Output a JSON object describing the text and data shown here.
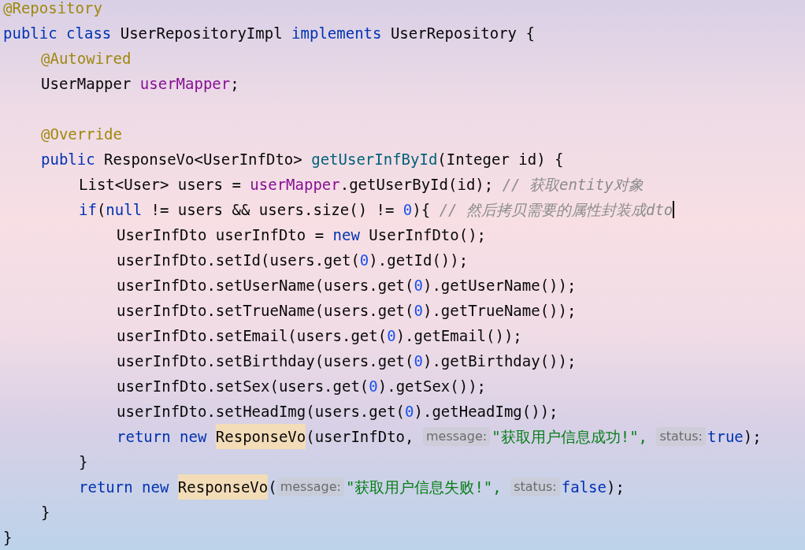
{
  "code": [
    {
      "tokens": [
        {
          "kind": "annotation",
          "text": "@Repository"
        }
      ]
    },
    {
      "tokens": [
        {
          "kind": "keyword",
          "text": "public class "
        },
        {
          "kind": "plain",
          "text": "UserRepositoryImpl "
        },
        {
          "kind": "keyword",
          "text": "implements "
        },
        {
          "kind": "plain",
          "text": "UserRepository {"
        }
      ],
      "children": [
        {
          "tokens": [
            {
              "kind": "annotation",
              "text": "@Autowired"
            }
          ]
        },
        {
          "tokens": [
            {
              "kind": "plain",
              "text": "UserMapper "
            },
            {
              "kind": "field",
              "text": "userMapper"
            },
            {
              "kind": "plain",
              "text": ";"
            }
          ]
        },
        {
          "blank_before": true,
          "tokens": [
            {
              "kind": "annotation",
              "text": "@Override"
            }
          ]
        },
        {
          "tokens": [
            {
              "kind": "keyword",
              "text": "public "
            },
            {
              "kind": "plain",
              "text": "ResponseVo<UserInfDto> "
            },
            {
              "kind": "method",
              "text": "getUserInfById"
            },
            {
              "kind": "plain",
              "text": "(Integer id) {"
            }
          ],
          "children": [
            {
              "tokens": [
                {
                  "kind": "plain",
                  "text": "List<User> users = "
                },
                {
                  "kind": "field",
                  "text": "userMapper"
                },
                {
                  "kind": "plain",
                  "text": ".getUserById(id); "
                },
                {
                  "kind": "comment",
                  "text": "// 获取entity对象"
                }
              ]
            },
            {
              "caret": true,
              "tokens": [
                {
                  "kind": "keyword",
                  "text": "if"
                },
                {
                  "kind": "plain",
                  "text": "("
                },
                {
                  "kind": "keyword",
                  "text": "null"
                },
                {
                  "kind": "plain",
                  "text": " != users && users.size() != "
                },
                {
                  "kind": "number",
                  "text": "0"
                },
                {
                  "kind": "plain",
                  "text": "){ "
                },
                {
                  "kind": "comment",
                  "text": "// 然后拷贝需要的属性封装成dto"
                }
              ],
              "children": [
                {
                  "tokens": [
                    {
                      "kind": "plain",
                      "text": "UserInfDto userInfDto = "
                    },
                    {
                      "kind": "keyword",
                      "text": "new "
                    },
                    {
                      "kind": "plain",
                      "text": "UserInfDto();"
                    }
                  ]
                },
                {
                  "tokens": [
                    {
                      "kind": "plain",
                      "text": "userInfDto.setId(users.get("
                    },
                    {
                      "kind": "number",
                      "text": "0"
                    },
                    {
                      "kind": "plain",
                      "text": ").getId());"
                    }
                  ]
                },
                {
                  "tokens": [
                    {
                      "kind": "plain",
                      "text": "userInfDto.setUserName(users.get("
                    },
                    {
                      "kind": "number",
                      "text": "0"
                    },
                    {
                      "kind": "plain",
                      "text": ").getUserName());"
                    }
                  ]
                },
                {
                  "tokens": [
                    {
                      "kind": "plain",
                      "text": "userInfDto.setTrueName(users.get("
                    },
                    {
                      "kind": "number",
                      "text": "0"
                    },
                    {
                      "kind": "plain",
                      "text": ").getTrueName());"
                    }
                  ]
                },
                {
                  "tokens": [
                    {
                      "kind": "plain",
                      "text": "userInfDto.setEmail(users.get("
                    },
                    {
                      "kind": "number",
                      "text": "0"
                    },
                    {
                      "kind": "plain",
                      "text": ").getEmail());"
                    }
                  ]
                },
                {
                  "tokens": [
                    {
                      "kind": "plain",
                      "text": "userInfDto.setBirthday(users.get("
                    },
                    {
                      "kind": "number",
                      "text": "0"
                    },
                    {
                      "kind": "plain",
                      "text": ").getBirthday());"
                    }
                  ]
                },
                {
                  "tokens": [
                    {
                      "kind": "plain",
                      "text": "userInfDto.setSex(users.get("
                    },
                    {
                      "kind": "number",
                      "text": "0"
                    },
                    {
                      "kind": "plain",
                      "text": ").getSex());"
                    }
                  ]
                },
                {
                  "tokens": [
                    {
                      "kind": "plain",
                      "text": "userInfDto.setHeadImg(users.get("
                    },
                    {
                      "kind": "number",
                      "text": "0"
                    },
                    {
                      "kind": "plain",
                      "text": ").getHeadImg());"
                    }
                  ]
                },
                {
                  "tokens": [
                    {
                      "kind": "keyword",
                      "text": "return new "
                    },
                    {
                      "kind": "highlight",
                      "text": "ResponseVo"
                    },
                    {
                      "kind": "plain",
                      "text": "(userInfDto, "
                    },
                    {
                      "kind": "hint",
                      "text": "message:"
                    },
                    {
                      "kind": "string",
                      "text": "\"获取用户信息成功!\", "
                    },
                    {
                      "kind": "hint",
                      "text": "status:"
                    },
                    {
                      "kind": "keyword",
                      "text": "true"
                    },
                    {
                      "kind": "plain",
                      "text": ");"
                    }
                  ]
                }
              ]
            },
            {
              "tokens": [
                {
                  "kind": "plain",
                  "text": "}"
                }
              ]
            },
            {
              "tokens": [
                {
                  "kind": "keyword",
                  "text": "return new "
                },
                {
                  "kind": "highlight",
                  "text": "ResponseVo"
                },
                {
                  "kind": "plain",
                  "text": "("
                },
                {
                  "kind": "hint",
                  "text": "message:"
                },
                {
                  "kind": "string",
                  "text": "\"获取用户信息失败!\", "
                },
                {
                  "kind": "hint",
                  "text": "status:"
                },
                {
                  "kind": "keyword",
                  "text": "false"
                },
                {
                  "kind": "plain",
                  "text": ");"
                }
              ]
            }
          ]
        },
        {
          "tokens": [
            {
              "kind": "plain",
              "text": "}"
            }
          ]
        }
      ]
    },
    {
      "tokens": [
        {
          "kind": "plain",
          "text": "}"
        }
      ]
    }
  ]
}
